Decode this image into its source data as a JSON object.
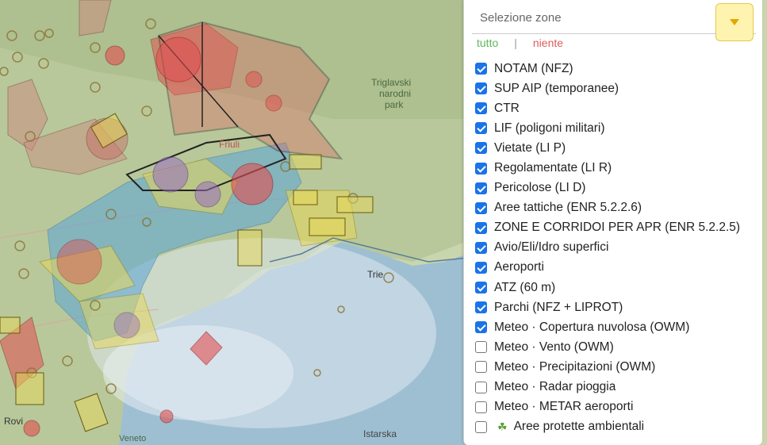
{
  "panel": {
    "select_label": "Selezione zone",
    "link_all": "tutto",
    "link_sep": "|",
    "link_none": "niente",
    "items": [
      {
        "label": "NOTAM (NFZ)",
        "checked": true
      },
      {
        "label": "SUP AIP (temporanee)",
        "checked": true
      },
      {
        "label": "CTR",
        "checked": true
      },
      {
        "label": "LIF (poligoni militari)",
        "checked": true
      },
      {
        "label": "Vietate (LI P)",
        "checked": true
      },
      {
        "label": "Regolamentate (LI R)",
        "checked": true
      },
      {
        "label": "Pericolose (LI D)",
        "checked": true
      },
      {
        "label": "Aree tattiche (ENR 5.2.2.6)",
        "checked": true
      },
      {
        "label": "ZONE E CORRIDOI PER APR (ENR 5.2.2.5)",
        "checked": true
      },
      {
        "label": "Avio/Eli/Idro superfici",
        "checked": true
      },
      {
        "label": "Aeroporti",
        "checked": true
      },
      {
        "label": "ATZ (60 m)",
        "checked": true
      },
      {
        "label": "Parchi (NFZ + LIPROT)",
        "checked": true
      },
      {
        "label": "Meteo · Copertura nuvolosa (OWM)",
        "checked": true
      },
      {
        "label": "Meteo · Vento (OWM)",
        "checked": false
      },
      {
        "label": "Meteo · Precipitazioni (OWM)",
        "checked": false
      },
      {
        "label": "Meteo · Radar pioggia",
        "checked": false
      },
      {
        "label": "Meteo · METAR aeroporti",
        "checked": false
      },
      {
        "label": "Aree protette ambientali",
        "checked": false,
        "icon": "leaf-icon"
      }
    ]
  },
  "map": {
    "labels": {
      "triglav": "Triglavski narodni park",
      "trieste": "Trie",
      "istarska": "Istarska",
      "veneto": "Veneto",
      "rovigo": "Rovi",
      "friuli": "Friuli"
    }
  }
}
